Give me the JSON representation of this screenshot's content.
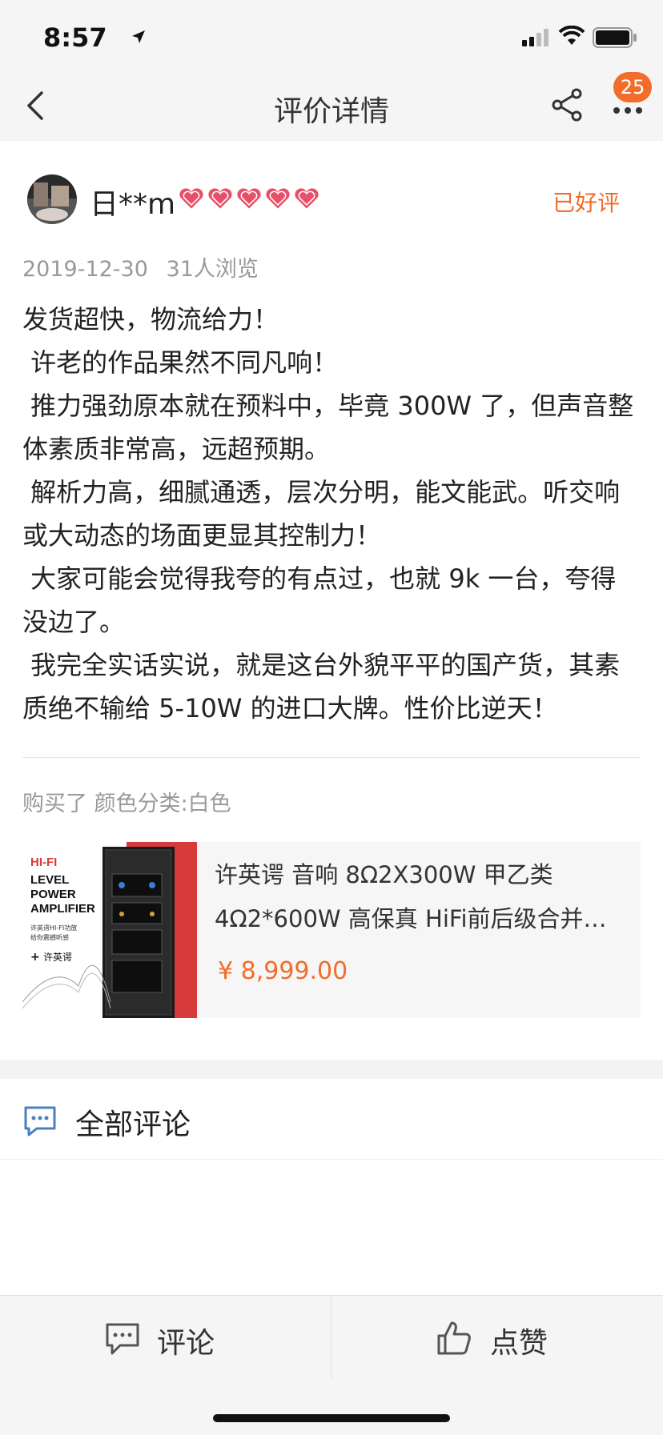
{
  "status_bar": {
    "time": "8:57"
  },
  "nav": {
    "title": "评价详情",
    "badge_count": "25"
  },
  "review": {
    "username": "日**m",
    "hearts_count": 5,
    "rating_label": "已好评",
    "date": "2019-12-30",
    "views": "31人浏览",
    "content": "发货超快，物流给力！\n 许老的作品果然不同凡响！\n 推力强劲原本就在预料中，毕竟 300W 了，但声音整体素质非常高，远超预期。\n 解析力高，细腻通透，层次分明，能文能武。听交响或大动态的场面更显其控制力！\n 大家可能会觉得我夸的有点过，也就 9k 一台，夸得没边了。\n 我完全实话实说，就是这台外貌平平的国产货，其素质绝不输给 5-10W 的进口大牌。性价比逆天！",
    "sku": "购买了 颜色分类:白色"
  },
  "product": {
    "title": "许英谔 音响 8Ω2X300W 甲乙类 4Ω2*600W 高保真 HiFi前后级合并…",
    "price": "¥ 8,999.00",
    "image_text": {
      "line1": "HI-FI",
      "line2": "LEVEL",
      "line3": "POWER",
      "line4": "AMPLIFIER",
      "sub1": "许英谔HI-FI功放",
      "sub2": "给你震撼听感",
      "brand": "许英谔"
    }
  },
  "comments": {
    "title": "全部评论"
  },
  "bottom_bar": {
    "comment_label": "评论",
    "like_label": "点赞"
  },
  "colors": {
    "accent": "#f26c2a",
    "heart": "#e8506a",
    "icon_blue": "#4a7fc1"
  }
}
